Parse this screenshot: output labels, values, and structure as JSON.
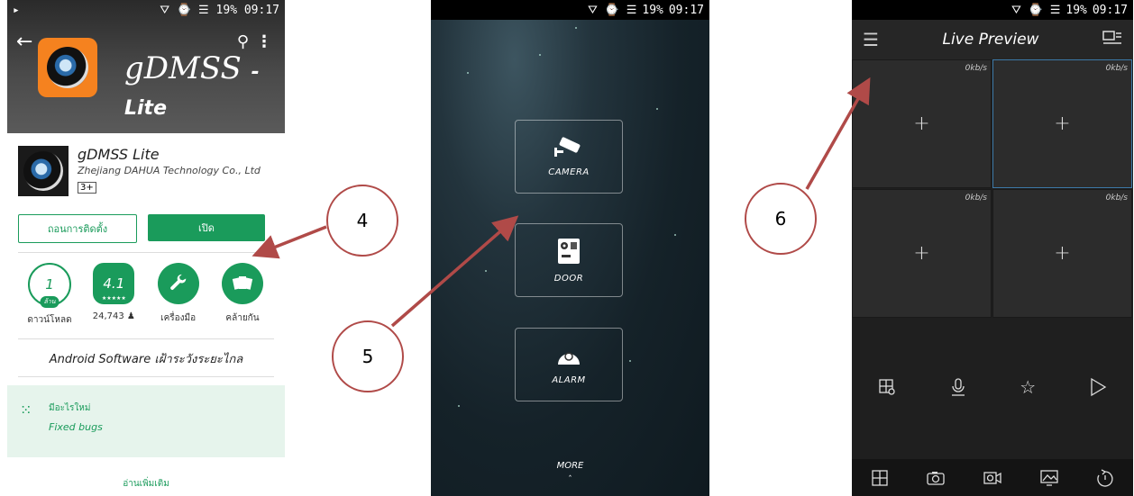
{
  "status": {
    "time": "09:17",
    "battery": "19%"
  },
  "phone1": {
    "brand": "gDMSS",
    "brand_suffix": "- Lite",
    "app_name": "gDMSS Lite",
    "developer": "Zhejiang DAHUA Technology Co., Ltd",
    "content_rating": "3+",
    "uninstall_label": "ถอนการติดตั้ง",
    "open_label": "เปิด",
    "stats": [
      {
        "value": "1",
        "sub": "ล้าน",
        "label": "ดาวน์โหลด"
      },
      {
        "value": "4.1",
        "sub": "★★★★★",
        "label": "24,743 ♟"
      },
      {
        "value": "",
        "sub": "",
        "label": "เครื่องมือ"
      },
      {
        "value": "",
        "sub": "",
        "label": "คล้ายกัน"
      }
    ],
    "description": "Android Software เฝ้าระวังระยะไกล",
    "whats_new_title": "มีอะไรใหม่",
    "whats_new_body": "Fixed bugs",
    "read_more": "อ่านเพิ่มเติม"
  },
  "phone2": {
    "camera_label": "CAMERA",
    "door_label": "DOOR",
    "alarm_label": "ALARM",
    "more_label": "MORE"
  },
  "phone3": {
    "title": "Live Preview",
    "cells": [
      {
        "rate": "0kb/s"
      },
      {
        "rate": "0kb/s"
      },
      {
        "rate": "0kb/s"
      },
      {
        "rate": "0kb/s"
      }
    ]
  },
  "callouts": {
    "c4": "4",
    "c5": "5",
    "c6": "6"
  },
  "colors": {
    "accent_green": "#1a9b5b",
    "callout_arrow": "#b04a48",
    "app_orange": "#f5821f"
  }
}
